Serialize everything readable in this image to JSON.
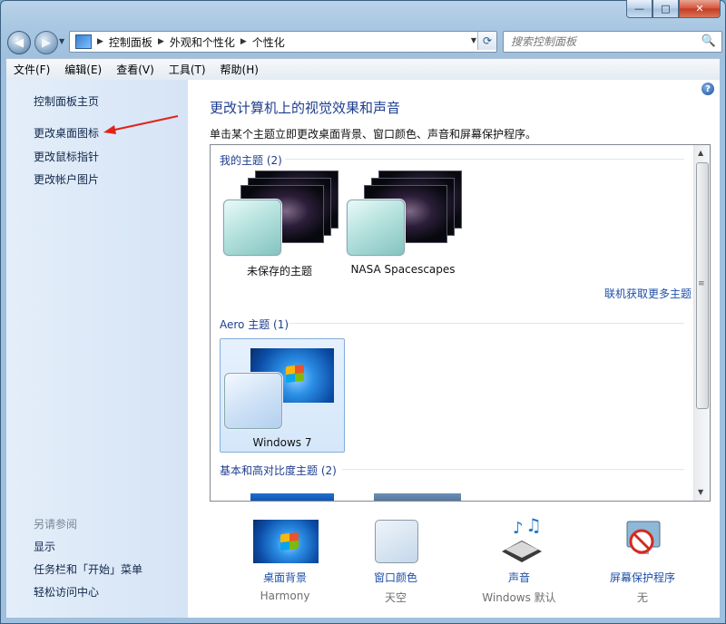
{
  "caption": {
    "min": "—",
    "max": "□",
    "close": "✕"
  },
  "nav": {
    "back_icon": "back-arrow-icon",
    "forward_icon": "forward-arrow-icon"
  },
  "address": {
    "crumbs": [
      "控制面板",
      "外观和个性化",
      "个性化"
    ],
    "separator": "▶",
    "dropdown": "▼",
    "refresh": "⟳"
  },
  "search": {
    "placeholder": "搜索控制面板",
    "icon": "🔍"
  },
  "menu": [
    "文件(F)",
    "编辑(E)",
    "查看(V)",
    "工具(T)",
    "帮助(H)"
  ],
  "sidebar": {
    "links": [
      "控制面板主页",
      "更改桌面图标",
      "更改鼠标指针",
      "更改帐户图片"
    ],
    "see_also_title": "另请参阅",
    "see_also": [
      "显示",
      "任务栏和「开始」菜单",
      "轻松访问中心"
    ]
  },
  "main": {
    "help": "?",
    "title": "更改计算机上的视觉效果和声音",
    "description": "单击某个主题立即更改桌面背景、窗口颜色、声音和屏幕保护程序。",
    "groups": {
      "my_themes": "我的主题 (2)",
      "aero": "Aero 主题 (1)",
      "basic": "基本和高对比度主题 (2)"
    },
    "themes": {
      "unsaved": "未保存的主题",
      "nasa": "NASA Spacescapes",
      "win7": "Windows 7"
    },
    "get_more": "联机获取更多主题"
  },
  "scrollbar": {
    "up": "▲",
    "down": "▼",
    "grip": "≡"
  },
  "bottom": {
    "background": {
      "label": "桌面背景",
      "value": "Harmony"
    },
    "color": {
      "label": "窗口颜色",
      "value": "天空"
    },
    "sound": {
      "label": "声音",
      "value": "Windows 默认"
    },
    "screensaver": {
      "label": "屏幕保护程序",
      "value": "无"
    }
  },
  "colors": {
    "link": "#1e4fa8",
    "title": "#1e3d8f",
    "annotation_arrow": "#e0241c"
  }
}
